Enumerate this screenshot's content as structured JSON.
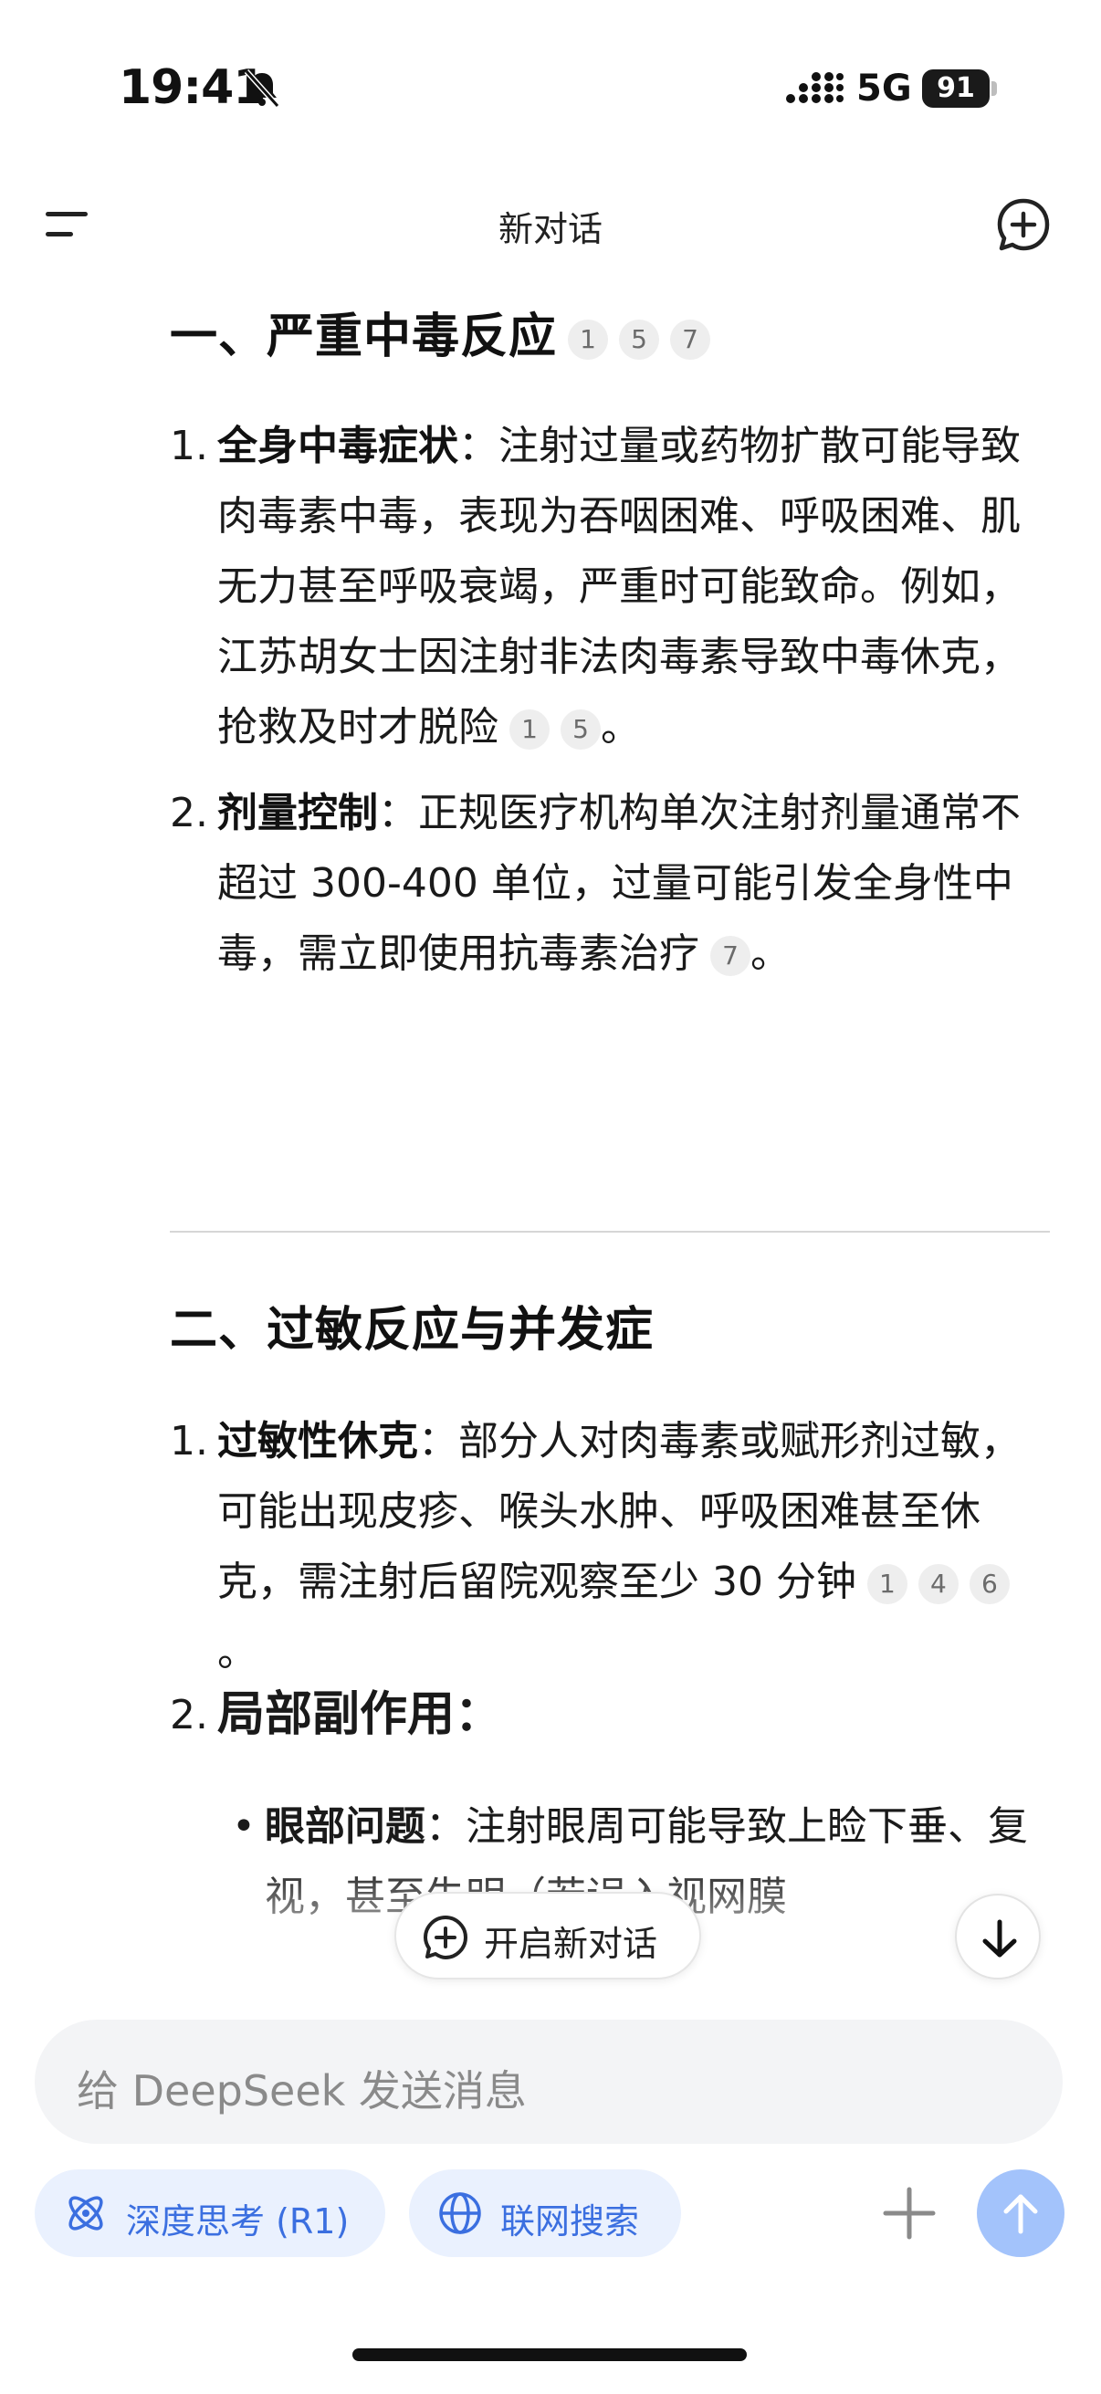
{
  "status_bar": {
    "time": "19:41",
    "network": "5G",
    "battery": "91"
  },
  "header": {
    "title": "新对话"
  },
  "section1": {
    "heading": "一、严重中毒反应",
    "citations": [
      "1",
      "5",
      "7"
    ],
    "items": [
      {
        "number": "1.",
        "title": "全身中毒症状",
        "text": "：注射过量或药物扩散可能导致肉毒素中毒，表现为吞咽困难、呼吸困难、肌无力甚至呼吸衰竭，严重时可能致命。例如，江苏胡女士因注射非法肉毒素导致中毒休克，抢救及时才脱险",
        "citations": [
          "1",
          "5"
        ],
        "end": "。"
      },
      {
        "number": "2.",
        "title": "剂量控制",
        "text": "：正规医疗机构单次注射剂量通常不超过 300-400 单位，过量可能引发全身性中毒，需立即使用抗毒素治疗",
        "citations": [
          "7"
        ],
        "end": "。"
      }
    ]
  },
  "section2": {
    "heading": "二、过敏反应与并发症",
    "items": [
      {
        "number": "1.",
        "title": "过敏性休克",
        "text": "：部分人对肉毒素或赋形剂过敏，可能出现皮疹、喉头水肿、呼吸困难甚至休克，需注射后留院观察至少 30 分钟",
        "citations": [
          "1",
          "4",
          "6"
        ],
        "end": "。"
      },
      {
        "number": "2.",
        "title": "局部副作用："
      }
    ],
    "sub_items": [
      {
        "bullet": "•",
        "title": "眼部问题",
        "text": "：注射眼周可能导致上睑下垂、复视，甚至失明（若误入视网膜"
      }
    ]
  },
  "floating": {
    "open_new_chat": "开启新对话"
  },
  "composer": {
    "placeholder": "给 DeepSeek 发送消息",
    "deep_think": "深度思考 (R1)",
    "web_search": "联网搜索"
  },
  "colors": {
    "accent": "#3b6fe0",
    "chip_bg": "#eaf1fe",
    "send_bg": "#a3c3fb"
  }
}
